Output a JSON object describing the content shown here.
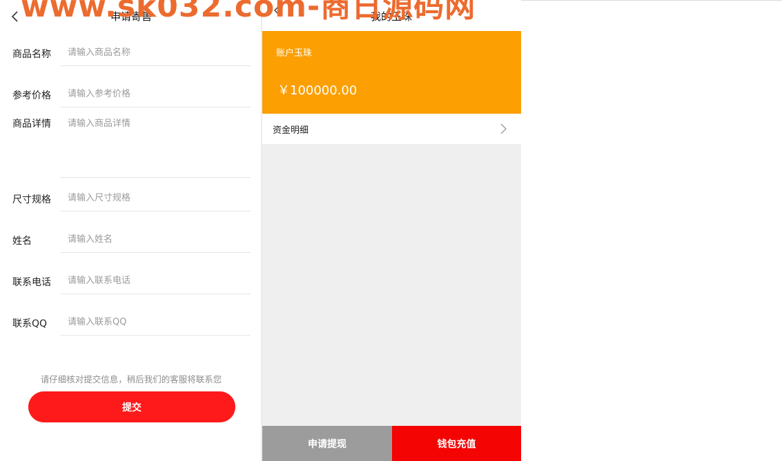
{
  "watermark": "www.sk032.com-商日源码网",
  "left": {
    "title": "申请寄售",
    "fields": [
      {
        "label": "商品名称",
        "placeholder": "请输入商品名称"
      },
      {
        "label": "参考价格",
        "placeholder": "请输入参考价格"
      },
      {
        "label": "商品详情",
        "placeholder": "请输入商品详情"
      },
      {
        "label": "尺寸规格",
        "placeholder": "请输入尺寸规格"
      },
      {
        "label": "姓名",
        "placeholder": "请输入姓名"
      },
      {
        "label": "联系电话",
        "placeholder": "请输入联系电话"
      },
      {
        "label": "联系QQ",
        "placeholder": "请输入联系QQ"
      }
    ],
    "notice": "请仔细核对提交信息，稍后我们的客服将联系您",
    "submit_label": "提交"
  },
  "right": {
    "title": "我的玉珠",
    "balance_label": "账户玉珠",
    "balance_amount": "￥100000.00",
    "detail_label": "资金明细",
    "withdraw_label": "申请提现",
    "recharge_label": "钱包充值"
  },
  "colors": {
    "accent_red": "#fe1a1a",
    "card_orange": "#fb9f03",
    "watermark_orange": "#ec6b2f",
    "withdraw_gray": "#9c9c9c",
    "recharge_red": "#f50404"
  },
  "icons": {
    "back": "chevron-left-icon",
    "detail": "chevron-right-icon"
  }
}
